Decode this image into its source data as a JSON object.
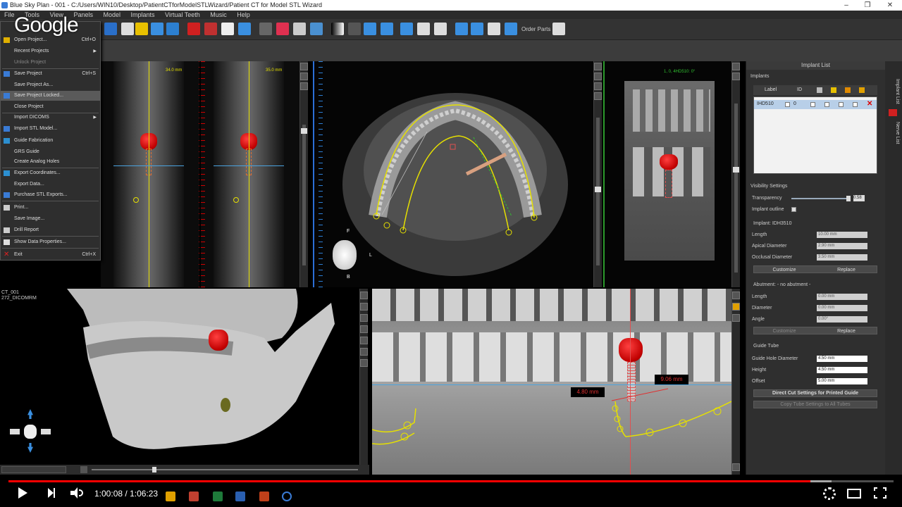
{
  "window": {
    "title": "Blue Sky Plan - 001 - C:/Users/WIN10/Desktop/PatientCTforModelSTLWizard/Patient CT for Model STL Wizard",
    "minimize": "–",
    "maximize": "❐",
    "close": "✕"
  },
  "menubar": [
    "File",
    "Tools",
    "View",
    "Panels",
    "Model",
    "Implants",
    "Virtual Teeth",
    "Music",
    "Help"
  ],
  "toolbar": {
    "order_parts": "Order Parts"
  },
  "watermark": "Google",
  "file_menu": {
    "items": [
      {
        "label": "Open Project...",
        "shortcut": "Ctrl+O"
      },
      {
        "label": "Recent Projects",
        "submenu": true
      },
      {
        "label": "Unlock Project",
        "disabled": true
      },
      {
        "label": "Save Project",
        "shortcut": "Ctrl+S"
      },
      {
        "label": "Save Project As..."
      },
      {
        "label": "Save Project Locked...",
        "highlighted": true
      },
      {
        "label": "Close Project"
      },
      {
        "label": "Import DICOMS",
        "submenu": true
      },
      {
        "label": "Import STL Model..."
      },
      {
        "label": "Guide Fabrication"
      },
      {
        "label": "GRS Guide"
      },
      {
        "label": "Create Analog Holes"
      },
      {
        "label": "Export Coordinates..."
      },
      {
        "label": "Export Data..."
      },
      {
        "label": "Purchase STL Exports..."
      },
      {
        "label": "Print..."
      },
      {
        "label": "Save Image..."
      },
      {
        "label": "Drill Report"
      },
      {
        "label": "Show Data Properties..."
      },
      {
        "label": "Exit",
        "shortcut": "Ctrl+X"
      }
    ]
  },
  "views": {
    "cross_section_1": {
      "measure": "34.0 mm"
    },
    "cross_section_2": {
      "measure": "35.0 mm"
    },
    "tangential": {
      "measure": "1, 0, 4HD510: 0°"
    },
    "axial": {
      "orient_f": "F",
      "orient_l": "L",
      "orient_b": "B"
    },
    "model_3d": {
      "label_1": "CT_001",
      "label_2": "272_DICOMRM"
    },
    "panoramic": {
      "measure_left": "4.80 mm",
      "measure_right": "9.06 mm"
    }
  },
  "panel": {
    "header": "Implant List",
    "implants_label": "Implants",
    "columns": {
      "label": "Label",
      "id": "ID"
    },
    "implant_row": {
      "label": "IHD510",
      "id": "0"
    },
    "visibility_settings": "Visibility Settings",
    "transparency_label": "Transparency",
    "transparency_value": "0.58",
    "implant_outline": "Implant outline",
    "implant_section": "Implant: IDH3510",
    "implant_fields": [
      {
        "label": "Length",
        "value": "10.00 mm"
      },
      {
        "label": "Apical Diameter",
        "value": "2.90 mm"
      },
      {
        "label": "Occlusal Diameter",
        "value": "3.50 mm"
      }
    ],
    "customize": "Customize",
    "replace": "Replace",
    "abutment_section": "Abutment: - no abutment -",
    "abutment_fields": [
      {
        "label": "Length",
        "value": "0.00 mm"
      },
      {
        "label": "Diameter",
        "value": "0.00 mm"
      },
      {
        "label": "Angle",
        "value": "0.00°"
      }
    ],
    "guide_tube_section": "Guide Tube",
    "guide_fields": [
      {
        "label": "Guide Hole Diameter",
        "value": "4.50 mm"
      },
      {
        "label": "Height",
        "value": "4.50 mm"
      },
      {
        "label": "Offset",
        "value": "5.00 mm"
      }
    ],
    "direct_cut": "Direct Cut Settings for Printed Guide",
    "copy_settings": "Copy Tube Settings to All Tubes"
  },
  "side_tabs": [
    "Implant List",
    "Nerve List"
  ],
  "player": {
    "time_current": "1:00:08",
    "time_sep": " / ",
    "time_total": "1:06:23",
    "progress": 0.906,
    "buffered": 0.93
  },
  "colors": {
    "accent": "#ff0000",
    "crown": "#e01010",
    "guide_line": "#e6e000",
    "axis_line": "#4aa3e0"
  }
}
